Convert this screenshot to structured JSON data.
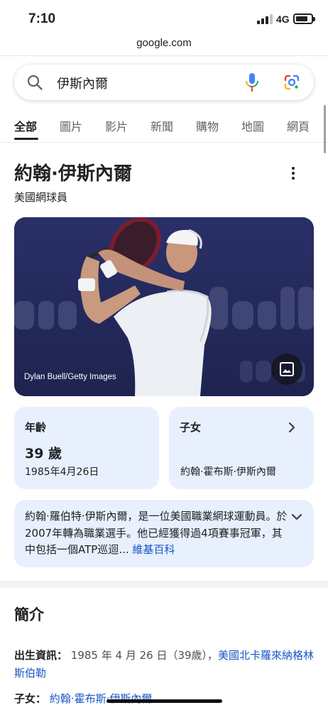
{
  "status_bar": {
    "time": "7:10",
    "network": "4G"
  },
  "browser": {
    "url": "google.com"
  },
  "search": {
    "query": "伊斯內爾"
  },
  "tabs": [
    {
      "label": "全部",
      "active": true
    },
    {
      "label": "圖片"
    },
    {
      "label": "影片"
    },
    {
      "label": "新聞"
    },
    {
      "label": "購物"
    },
    {
      "label": "地圖"
    },
    {
      "label": "網頁"
    }
  ],
  "entity": {
    "title": "約翰·伊斯內爾",
    "subtitle": "美國網球員",
    "image_credit": "Dylan Buell/Getty Images"
  },
  "age_card": {
    "label": "年齡",
    "value": "39 歲",
    "date": "1985年4月26日"
  },
  "kids_card": {
    "label": "子女",
    "name": "約翰·霍布斯·伊斯內爾"
  },
  "description": {
    "text": "約翰·羅伯特·伊斯內爾，是一位美國職業網球運動員。於2007年轉為職業選手。他已經獲得過4項賽事冠軍，其中包括一個ATP巡迴",
    "ellipsis": "...",
    "source_link": "維基百科"
  },
  "about": {
    "title": "簡介",
    "birth_label": "出生資訊：",
    "birth_text": "1985 年 4 月 26 日（39歲）",
    "birth_sep": "，",
    "birth_place": "美國北卡羅來納格林斯伯勒",
    "kids_label": "子女：",
    "kids_value": "約翰·霍布斯·伊斯內爾"
  },
  "colors": {
    "accent": "#1a56c8",
    "card_bg": "#e8f0fe",
    "hero_bg": "#262c5c"
  }
}
